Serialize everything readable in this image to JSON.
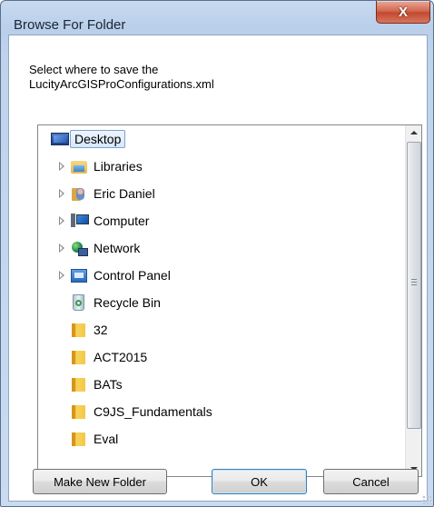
{
  "window": {
    "title": "Browse For Folder",
    "close_label": "X"
  },
  "description": {
    "line1": "Select where to save the",
    "line2": "LucityArcGISProConfigurations.xml"
  },
  "tree": {
    "items": [
      {
        "label": "Desktop",
        "icon": "desktop-icon",
        "expandable": false,
        "selected": true
      },
      {
        "label": "Libraries",
        "icon": "libraries-icon",
        "expandable": true
      },
      {
        "label": "Eric Daniel",
        "icon": "user-folder-icon",
        "expandable": true
      },
      {
        "label": "Computer",
        "icon": "computer-icon",
        "expandable": true
      },
      {
        "label": "Network",
        "icon": "network-icon",
        "expandable": true
      },
      {
        "label": "Control Panel",
        "icon": "control-panel-icon",
        "expandable": true
      },
      {
        "label": "Recycle Bin",
        "icon": "recycle-bin-icon",
        "expandable": false
      },
      {
        "label": "32",
        "icon": "folder-icon",
        "expandable": false
      },
      {
        "label": "ACT2015",
        "icon": "folder-icon",
        "expandable": false
      },
      {
        "label": "BATs",
        "icon": "folder-icon",
        "expandable": false
      },
      {
        "label": "C9JS_Fundamentals",
        "icon": "folder-icon",
        "expandable": false
      },
      {
        "label": "Eval",
        "icon": "folder-icon",
        "expandable": false
      }
    ]
  },
  "buttons": {
    "make_new_folder": "Make New Folder",
    "ok": "OK",
    "cancel": "Cancel"
  }
}
